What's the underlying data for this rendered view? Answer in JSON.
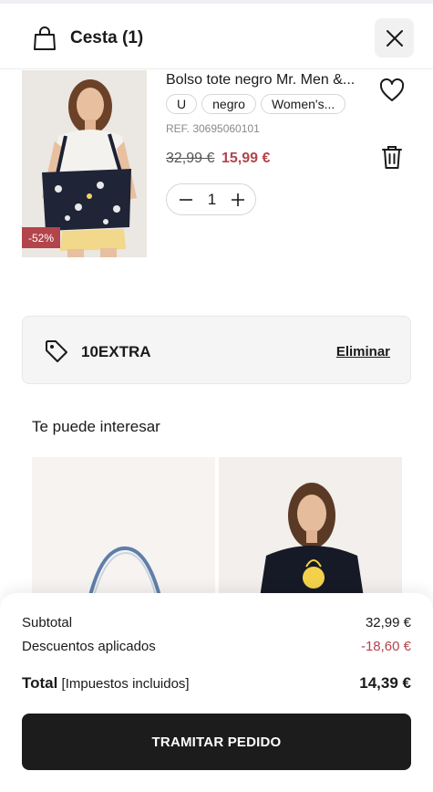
{
  "header": {
    "title": "Cesta (1)",
    "bag_icon": "shopping-bag-icon",
    "close_icon": "close-icon"
  },
  "product": {
    "name": "Bolso tote negro Mr. Men &...",
    "tags": [
      "U",
      "negro",
      "Women's..."
    ],
    "ref": "REF. 30695060101",
    "price_old": "32,99 €",
    "price_new": "15,99 €",
    "discount_badge": "-52%",
    "quantity": "1",
    "wishlist_icon": "heart-icon",
    "delete_icon": "trash-icon"
  },
  "coupon": {
    "code": "10EXTRA",
    "remove_label": "Eliminar",
    "icon": "tag-icon"
  },
  "recommendations": {
    "title": "Te puede interesar"
  },
  "summary": {
    "subtotal_label": "Subtotal",
    "subtotal_value": "32,99 €",
    "discount_label": "Descuentos aplicados",
    "discount_value": "-18,60 €",
    "total_label": "Total",
    "total_note": "[Impuestos incluidos]",
    "total_value": "14,39 €",
    "checkout_label": "TRAMITAR PEDIDO"
  },
  "colors": {
    "accent_sale": "#b3444b",
    "button_dark": "#1c1c1c"
  }
}
